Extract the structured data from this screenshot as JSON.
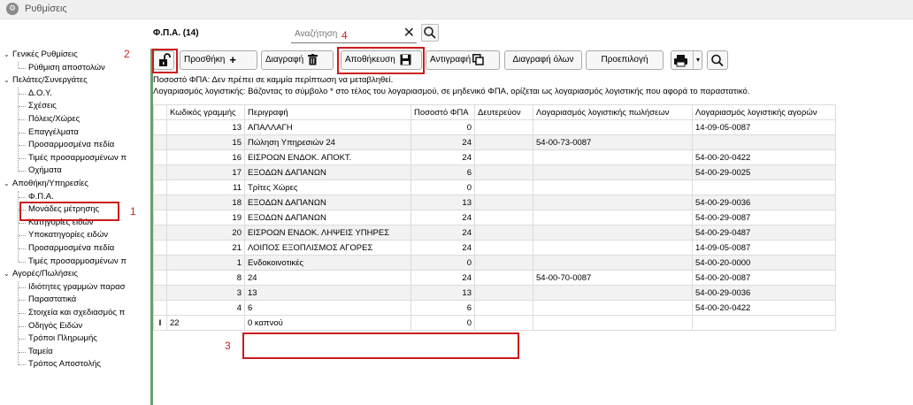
{
  "window": {
    "title": "Ρυθμίσεις"
  },
  "tree": {
    "groups": [
      {
        "label": "Γενικές Ρυθμίσεις",
        "items": [
          "Ρύθμιση αποστολών"
        ]
      },
      {
        "label": "Πελάτες/Συνεργάτες",
        "items": [
          "Δ.Ο.Υ.",
          "Σχέσεις",
          "Πόλεις/Χώρες",
          "Επαγγέλματα",
          "Προσαρμοσμένα πεδία",
          "Τιμές προσαρμοσμένων π",
          "Οχήματα"
        ]
      },
      {
        "label": "Αποθήκη/Υπηρεσίες",
        "items": [
          "Φ.Π.Α.",
          "Μονάδες μέτρησης",
          "Κατηγορίες ειδών",
          "Υποκατηγορίες ειδών",
          "Προσαρμοσμένα πεδία",
          "Τιμές προσαρμοσμένων π"
        ]
      },
      {
        "label": "Αγορές/Πωλήσεις",
        "items": [
          "Ιδιότητες γραμμών παρασ",
          "Παραστατικά",
          "Στοιχεία και σχεδιασμός π",
          "Οδηγός Ειδών",
          "Τρόποι Πληρωμής",
          "Ταμεία",
          "Τρόπος Αποστολής"
        ]
      }
    ]
  },
  "form": {
    "title": "Φ.Π.Α. (14)"
  },
  "search": {
    "placeholder": "Αναζήτηση",
    "value": ""
  },
  "toolbar": {
    "add": "Προσθήκη",
    "delete": "Διαγραφή",
    "save": "Αποθήκευση",
    "copy": "Αντιγραφή",
    "delete_all": "Διαγραφή όλων",
    "default": "Προεπιλογή"
  },
  "messages": [
    "Ποσοστό ΦΠΑ: Δεν πρέπει σε καμμία περίπτωση να μεταβληθεί.",
    "Λογαριασμός λογιστικής: Βάζοντας το σύμβολο * στο τέλος του λογαριασμού, σε μηδενικό ΦΠΑ, ορίζεται ως λογαριασμός λογιστικής που αφορά το παραστατικό."
  ],
  "table": {
    "columns": [
      "Κωδικός γραμμής",
      "Περιγραφή",
      "Ποσοστό ΦΠΑ",
      "Δευτερεύον",
      "Λογαριασμός λογιστικής πωλήσεων",
      "Λογαριασμός λογιστικής αγορών"
    ],
    "rows": [
      [
        "13",
        "ΑΠΑΛΛΑΓΗ",
        "0",
        "",
        "",
        "14-09-05-0087"
      ],
      [
        "15",
        "Πώληση Υπηρεσιών 24",
        "24",
        "",
        "54-00-73-0087",
        ""
      ],
      [
        "16",
        "ΕΙΣΡΟΩΝ ΕΝΔΟΚ. ΑΠΟΚΤ.",
        "24",
        "",
        "",
        "54-00-20-0422"
      ],
      [
        "17",
        "ΕΞΟΔΩΝ ΔΑΠΑΝΩΝ",
        "6",
        "",
        "",
        "54-00-29-0025"
      ],
      [
        "11",
        "Τρίτες Χώρες",
        "0",
        "",
        "",
        ""
      ],
      [
        "18",
        "ΕΞΟΔΩΝ ΔΑΠΑΝΩΝ",
        "13",
        "",
        "",
        "54-00-29-0036"
      ],
      [
        "19",
        "ΕΞΟΔΩΝ ΔΑΠΑΝΩΝ",
        "24",
        "",
        "",
        "54-00-29-0087"
      ],
      [
        "20",
        "ΕΙΣΡΟΩΝ ΕΝΔΟΚ. ΛΗΨΕΙΣ ΥΠΗΡΕΣ",
        "24",
        "",
        "",
        "54-00-29-0487"
      ],
      [
        "21",
        "ΛΟΙΠΟΣ ΕΞΟΠΛΙΣΜΟΣ ΑΓΟΡΕΣ",
        "24",
        "",
        "",
        "14-09-05-0087"
      ],
      [
        "1",
        "Ενδοκοινοτικές",
        "0",
        "",
        "",
        "54-00-20-0000"
      ],
      [
        "8",
        "24",
        "24",
        "",
        "54-00-70-0087",
        "54-00-20-0087"
      ],
      [
        "3",
        "13",
        "13",
        "",
        "",
        "54-00-29-0036"
      ],
      [
        "4",
        "6",
        "6",
        "",
        "",
        "54-00-20-0422"
      ]
    ],
    "new_row": {
      "indicator": "I",
      "code": "22",
      "description": "0 καπνού",
      "rate": "0"
    }
  },
  "annotations": [
    "1",
    "2",
    "3",
    "4"
  ],
  "colors": {
    "highlight": "#cc1a1a",
    "splitter": "#6aa06a"
  }
}
